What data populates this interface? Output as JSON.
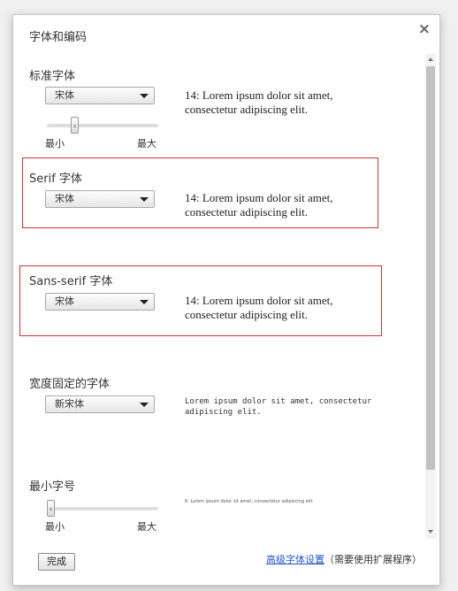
{
  "dialog": {
    "title": "字体和编码",
    "close_glyph": "×"
  },
  "standard": {
    "label": "标准字体",
    "font": "宋体",
    "sample": [
      "14: Lorem ipsum dolor sit amet,",
      "consectetur adipiscing elit."
    ],
    "slider_min": "最小",
    "slider_max": "最大",
    "slider_value_fraction": 0.23
  },
  "serif": {
    "label": "Serif 字体",
    "font": "宋体",
    "sample": [
      "14: Lorem ipsum dolor sit amet,",
      "consectetur adipiscing elit."
    ]
  },
  "sans_serif": {
    "label": "Sans-serif 字体",
    "font": "宋体",
    "sample": [
      "14: Lorem ipsum dolor sit amet,",
      "consectetur adipiscing elit."
    ]
  },
  "fixed": {
    "label": "宽度固定的字体",
    "font": "新宋体",
    "sample": [
      "Lorem ipsum dolor sit amet, consectetur",
      "adipiscing elit."
    ]
  },
  "minimum": {
    "label": "最小字号",
    "sample": "6: Lorem ipsum dolor sit amet, consectetur adipiscing elit.",
    "slider_min": "最小",
    "slider_max": "最大",
    "slider_value_fraction": 0.0
  },
  "footer": {
    "done_label": "完成",
    "advanced_link": "高级字体设置",
    "advanced_note": "（需要使用扩展程序）"
  },
  "colors": {
    "highlight_border": "#d93030",
    "link": "#2255cc"
  }
}
